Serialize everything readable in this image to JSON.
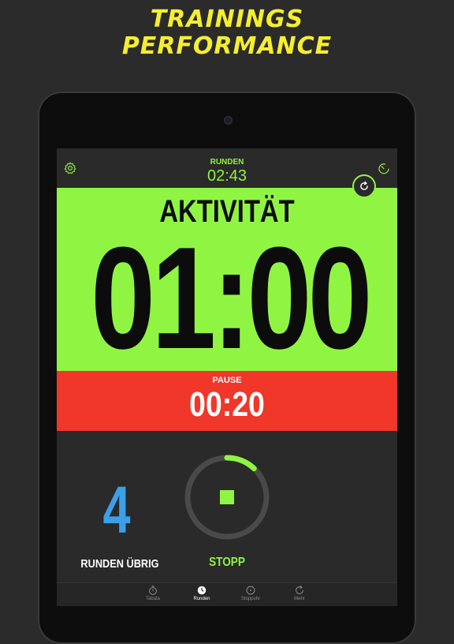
{
  "promo": {
    "line1": "TRAININGS",
    "line2": "PERFORMANCE"
  },
  "header": {
    "rounds_label": "RUNDEN",
    "rounds_time": "02:43",
    "left_icon": "gear-icon",
    "right_icon": "timer-icon"
  },
  "active_panel": {
    "label": "AKTIVITÄT",
    "time": "01:00",
    "color": "#8ff542",
    "reset_icon": "refresh-icon"
  },
  "pause_panel": {
    "label": "PAUSE",
    "time": "00:20",
    "color": "#f1362a"
  },
  "controls": {
    "rounds_left_value": "4",
    "rounds_left_label": "RUNDEN ÜBRIG",
    "stop_label": "STOPP",
    "progress_fraction": 0.12,
    "accent": "#8ff542",
    "rounds_color": "#3aa0ea"
  },
  "tabs": [
    {
      "label": "Tabata",
      "icon": "stopwatch-icon",
      "active": false
    },
    {
      "label": "Runden",
      "icon": "clock-icon",
      "active": true
    },
    {
      "label": "Stoppuhr",
      "icon": "stopwatch-circle-icon",
      "active": false
    },
    {
      "label": "Mehr",
      "icon": "refresh-circle-icon",
      "active": false
    }
  ]
}
